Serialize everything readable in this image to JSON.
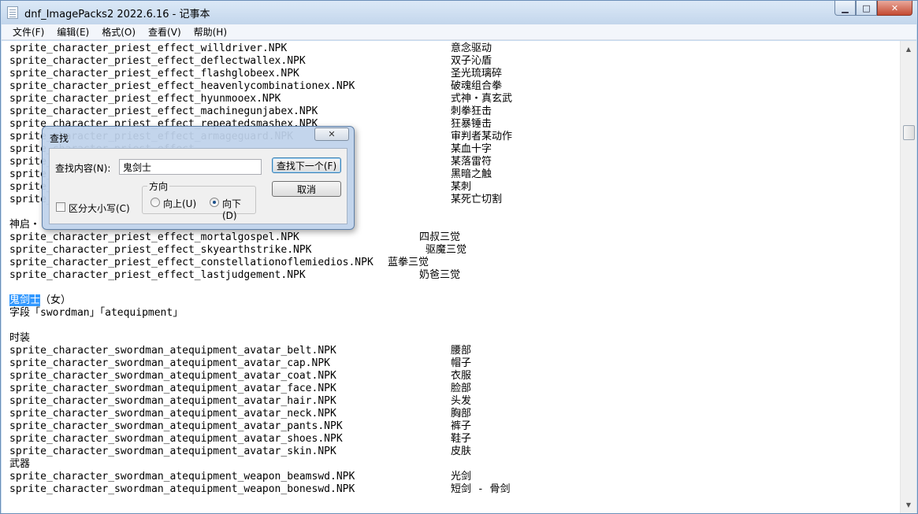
{
  "window": {
    "title": "dnf_ImagePacks2 2022.6.16 - 记事本",
    "minimize_glyph": "▁",
    "maximize_glyph": "□",
    "close_glyph": "✕"
  },
  "menu": [
    "文件(F)",
    "编辑(E)",
    "格式(O)",
    "查看(V)",
    "帮助(H)"
  ],
  "editor": {
    "lines": [
      {
        "text": "sprite_character_priest_effect_willdriver.NPK",
        "desc": "意念驱动",
        "desc_col": 560
      },
      {
        "text": "sprite_character_priest_effect_deflectwallex.NPK",
        "desc": "双子沁盾",
        "desc_col": 560
      },
      {
        "text": "sprite_character_priest_effect_flashglobeex.NPK",
        "desc": "圣光琉璃碎",
        "desc_col": 560
      },
      {
        "text": "sprite_character_priest_effect_heavenlycombinationex.NPK",
        "desc": "破魂组合拳",
        "desc_col": 560
      },
      {
        "text": "sprite_character_priest_effect_hyunmooex.NPK",
        "desc": "式神・真玄武",
        "desc_col": 560
      },
      {
        "text": "sprite_character_priest_effect_machinegunjabex.NPK",
        "desc": "刺拳狂击",
        "desc_col": 560
      },
      {
        "text": "sprite_character_priest_effect_repeatedsmashex.NPK",
        "desc": "狂暴锤击",
        "desc_col": 560
      },
      {
        "text": "sprite_character_priest_effect_armageguard.NPK",
        "desc": "审判者某动作",
        "desc_col": 560
      },
      {
        "text": "sprite_character_priest_effect_",
        "desc": "某血十字",
        "desc_col": 560
      },
      {
        "text": "sprite_character_priest_effect_                      K",
        "desc": "某落雷符",
        "desc_col": 560
      },
      {
        "text": "sprite_character_priest_effect_",
        "desc": "黑暗之触",
        "desc_col": 560
      },
      {
        "text": "sprite_character_priest_effect_",
        "desc": "某刺",
        "desc_col": 560
      },
      {
        "text": "sprite_character_priest_effect_",
        "desc": "某死亡切割",
        "desc_col": 560
      },
      {
        "text": "",
        "desc": "",
        "desc_col": 560
      },
      {
        "text": "神启・",
        "desc": "",
        "desc_col": 560
      },
      {
        "text": "sprite_character_priest_effect_mortalgospel.NPK",
        "desc": "四叔三觉",
        "desc_col": 520
      },
      {
        "text": "sprite_character_priest_effect_skyearthstrike.NPK",
        "desc": "驱魔三觉",
        "desc_col": 528
      },
      {
        "text": "sprite_character_priest_effect_constellationoflemiedios.NPK",
        "desc": "蓝拳三觉",
        "desc_col": 480
      },
      {
        "text": "sprite_character_priest_effect_lastjudgement.NPK",
        "desc": "奶爸三觉",
        "desc_col": 520
      },
      {
        "text": "",
        "desc": "",
        "desc_col": 560
      },
      {
        "text": "（女）",
        "sel": "鬼剑士",
        "desc": "",
        "desc_col": 560
      },
      {
        "text": "字段「swordman」「atequipment」",
        "desc": "",
        "desc_col": 560
      },
      {
        "text": "",
        "desc": "",
        "desc_col": 560
      },
      {
        "text": "时装",
        "desc": "",
        "desc_col": 560
      },
      {
        "text": "sprite_character_swordman_atequipment_avatar_belt.NPK",
        "desc": "腰部",
        "desc_col": 560
      },
      {
        "text": "sprite_character_swordman_atequipment_avatar_cap.NPK",
        "desc": "帽子",
        "desc_col": 560
      },
      {
        "text": "sprite_character_swordman_atequipment_avatar_coat.NPK",
        "desc": "衣服",
        "desc_col": 560
      },
      {
        "text": "sprite_character_swordman_atequipment_avatar_face.NPK",
        "desc": "脸部",
        "desc_col": 560
      },
      {
        "text": "sprite_character_swordman_atequipment_avatar_hair.NPK",
        "desc": "头发",
        "desc_col": 560
      },
      {
        "text": "sprite_character_swordman_atequipment_avatar_neck.NPK",
        "desc": "胸部",
        "desc_col": 560
      },
      {
        "text": "sprite_character_swordman_atequipment_avatar_pants.NPK",
        "desc": "裤子",
        "desc_col": 560
      },
      {
        "text": "sprite_character_swordman_atequipment_avatar_shoes.NPK",
        "desc": "鞋子",
        "desc_col": 560
      },
      {
        "text": "sprite_character_swordman_atequipment_avatar_skin.NPK",
        "desc": "皮肤",
        "desc_col": 560
      },
      {
        "text": "武器",
        "desc": "",
        "desc_col": 560
      },
      {
        "text": "sprite_character_swordman_atequipment_weapon_beamswd.NPK",
        "desc": "光剑",
        "desc_col": 560
      },
      {
        "text": "sprite_character_swordman_atequipment_weapon_boneswd.NPK",
        "desc": "短剑 - 骨剑",
        "desc_col": 560
      }
    ]
  },
  "find_dialog": {
    "title": "查找",
    "close_glyph": "✕",
    "find_label": "查找内容(N):",
    "find_value": "鬼剑士",
    "find_next_label": "查找下一个(F)",
    "cancel_label": "取消",
    "direction_label": "方向",
    "up_label": "向上(U)",
    "down_label": "向下(D)",
    "direction_selected": "down",
    "match_case_label": "区分大小写(C)",
    "match_case_checked": false
  }
}
